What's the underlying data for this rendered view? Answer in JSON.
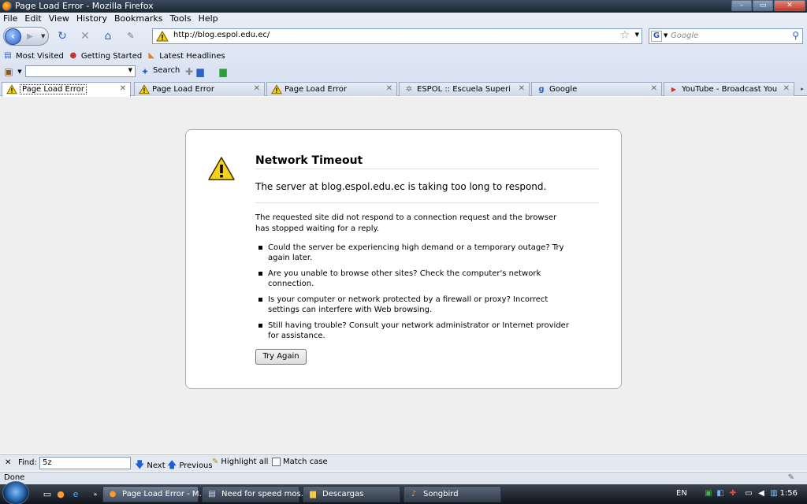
{
  "window": {
    "title": "Page Load Error - Mozilla Firefox",
    "controls": [
      "–",
      "▭",
      "✕"
    ]
  },
  "menu": [
    "File",
    "Edit",
    "View",
    "History",
    "Bookmarks",
    "Tools",
    "Help"
  ],
  "nav": {
    "url": "http://blog.espol.edu.ec/",
    "search_placeholder": "Google"
  },
  "bookmarks": [
    {
      "label": "Most Visited",
      "icon": "most-visited-icon"
    },
    {
      "label": "Getting Started",
      "icon": "getting-started-icon"
    },
    {
      "label": "Latest Headlines",
      "icon": "rss-icon"
    }
  ],
  "toolbar3": {
    "search_label": "Search"
  },
  "tabs": [
    {
      "label": "Page Load Error",
      "icon": "warning-icon",
      "active": true
    },
    {
      "label": "Page Load Error",
      "icon": "warning-icon"
    },
    {
      "label": "Page Load Error",
      "icon": "warning-icon"
    },
    {
      "label": "ESPOL :: Escuela Superior P...",
      "icon": "loading-icon"
    },
    {
      "label": "Google",
      "icon": "google-icon"
    },
    {
      "label": "YouTube - Broadcast Yours...",
      "icon": "youtube-icon"
    }
  ],
  "error": {
    "title": "Network Timeout",
    "subtitle": "The server at blog.espol.edu.ec is taking too long to respond.",
    "description": "The requested site did not respond to a connection request and the browser has stopped waiting for a reply.",
    "suggestions": [
      "Could the server be experiencing high demand or a temporary outage? Try again later.",
      "Are you unable to browse other sites? Check the computer's network connection.",
      "Is your computer or network protected by a firewall or proxy? Incorrect settings can interfere with Web browsing.",
      "Still having trouble? Consult your network administrator or Internet provider for assistance."
    ],
    "button": "Try Again"
  },
  "findbar": {
    "label": "Find:",
    "value": "5z",
    "next": "Next",
    "previous": "Previous",
    "highlight": "Highlight all",
    "matchcase": "Match case"
  },
  "status": "Done",
  "taskbar": {
    "tasks": [
      {
        "label": "Page Load Error - M...",
        "icon": "firefox-icon",
        "active": true
      },
      {
        "label": "Need for speed mos...",
        "icon": "notepad-icon"
      },
      {
        "label": "Descargas",
        "icon": "folder-icon"
      },
      {
        "label": "Songbird",
        "icon": "songbird-icon"
      }
    ],
    "language": "EN",
    "clock": "1:56"
  }
}
